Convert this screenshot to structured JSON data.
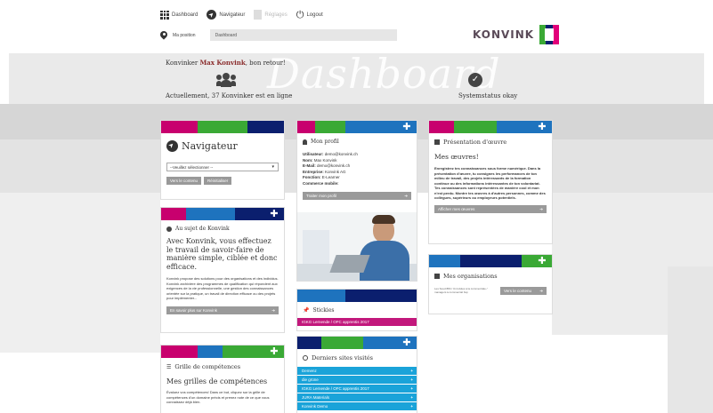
{
  "nav": {
    "dashboard": "Dashboard",
    "navigator": "Navigateur",
    "disabled": "Réglages",
    "logout": "Logout"
  },
  "position": {
    "label": "Ma position",
    "value": "Dashboard"
  },
  "logo": {
    "text": "KONVINK"
  },
  "hero": {
    "title": "Dashboard",
    "greeting_prefix": "Konvinker",
    "greeting_name": "Max Konvink",
    "greeting_suffix": ", bon retour!",
    "online": "Actuellement, 37 Konvinker est en ligne",
    "system": "Systemstatus okay"
  },
  "navigator_card": {
    "title": "Navigateur",
    "select": "--Veuillez sélectionner --",
    "btn1": "Vers le contenu",
    "btn2": "Réinitialiser"
  },
  "about_card": {
    "title": "Au sujet de Konvink",
    "headline": "Avec Konvink, vous effectuez le travail de savoir-faire de manière simple, ciblée et donc efficace.",
    "body": "Konvink propose des solutions pour des organisations et des individus. Konvink archivière des programmes de qualification qui répondent aux exigences de la vie professionnelle, une gestion des connaissances orientée sur la pratique, un travail de direction efficace ou des projets pour implémenter...",
    "button": "En savoir plus sur Konvink"
  },
  "skills_card": {
    "title": "Grille de compétences",
    "headline": "Mes grilles de compétences",
    "body": "Évaluez vos compétences! Dans ce but, cliquez sur la grille de compétences d'un domaine précis et prenez note de ce que vous connaissez déjà bien."
  },
  "profile_card": {
    "title": "Mon profil",
    "rows": [
      {
        "k": "Utilisateur:",
        "v": "demo@konvink.ch"
      },
      {
        "k": "Nom:",
        "v": "Max Konvink"
      },
      {
        "k": "E-Mail:",
        "v": "demo@konvink.ch"
      },
      {
        "k": "Entreprise:",
        "v": "Konvink AG"
      },
      {
        "k": "Fonction:",
        "v": "E-Learner"
      },
      {
        "k": "Commerce mobile:",
        "v": ""
      }
    ],
    "button": "Traiter mon profil"
  },
  "stickies_card": {
    "title": "Stickies",
    "item": "IGKG Lernende / OFC apprentis 2017"
  },
  "visits_card": {
    "title": "Derniers sites visités",
    "items": [
      "Demenz",
      "die grüne",
      "IGKG Lernende / OFC apprentis 2017",
      "JURA Materials",
      "Konvink Demo"
    ]
  },
  "works_card": {
    "title": "Présentation d'œuvre",
    "headline": "Mes œuvres!",
    "body": "Enregistrez tes connaissances sous forme numérique. Dans la présentation d'œuvre, tu consignes les performances de ton milieu de travail, des projets intéressants de la formation continue ou des informations intéressantes de ton volontariat. Tes connaissances sont représentées de manière cool et mon n'est perdu. Montre tes œuvres à d'autres personnes, comme des collègues, supérieurs ou employeurs potentiels.",
    "button": "Afficher mes œuvres"
  },
  "orgs_card": {
    "title": "Mes organisations",
    "org_text": "Les Soud 884 / Un'odules à la commerciale / managers à commercial bsp",
    "button": "Vers le contenu"
  },
  "colors": {
    "magenta": "#c8006e",
    "green": "#3aa935",
    "blue": "#1e73be",
    "navy": "#0b1f6e",
    "cyan": "#1aa3d9",
    "stickyPink": "#c2187c"
  }
}
